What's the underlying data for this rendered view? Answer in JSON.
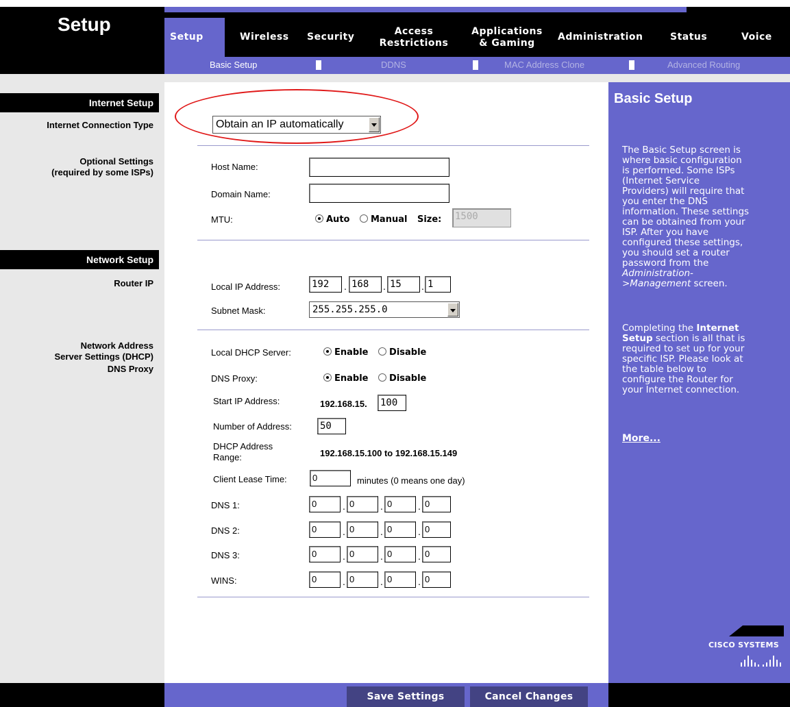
{
  "header": {
    "section_title": "Setup",
    "tabs": [
      {
        "label": "Setup"
      },
      {
        "label": "Wireless"
      },
      {
        "label": "Security"
      },
      {
        "label": "Access Restrictions",
        "line1": "Access",
        "line2": "Restrictions"
      },
      {
        "label": "Applications & Gaming",
        "line1": "Applications",
        "line2": "& Gaming"
      },
      {
        "label": "Administration"
      },
      {
        "label": "Status"
      },
      {
        "label": "Voice"
      }
    ],
    "subtabs": [
      {
        "label": "Basic Setup"
      },
      {
        "label": "DDNS"
      },
      {
        "label": "MAC Address Clone"
      },
      {
        "label": "Advanced Routing"
      }
    ]
  },
  "left": {
    "internet_setup": "Internet Setup",
    "internet_connection_type": "Internet Connection Type",
    "optional_settings_1": "Optional Settings",
    "optional_settings_2": "(required by some ISPs)",
    "network_setup": "Network Setup",
    "router_ip": "Router IP",
    "nas_1": "Network Address",
    "nas_2": "Server Settings (DHCP)",
    "dns_proxy": "DNS Proxy"
  },
  "form": {
    "connection_type": "Obtain an IP automatically",
    "host_name_label": "Host Name:",
    "host_name_value": "",
    "domain_name_label": "Domain Name:",
    "domain_name_value": "",
    "mtu_label": "MTU:",
    "mtu_auto": "Auto",
    "mtu_manual": "Manual",
    "mtu_size_label": "Size:",
    "mtu_size": "1500",
    "local_ip_label": "Local IP Address:",
    "local_ip": [
      "192",
      "168",
      "15",
      "1"
    ],
    "subnet_label": "Subnet Mask:",
    "subnet_value": "255.255.255.0",
    "dhcp_label": "Local DHCP Server:",
    "enable": "Enable",
    "disable": "Disable",
    "dns_proxy_label": "DNS Proxy:",
    "start_ip_label": "Start IP Address:",
    "start_ip_prefix": "192.168.15.",
    "start_ip_value": "100",
    "num_addr_label": "Number of Address:",
    "num_addr_value": "50",
    "range_label_1": "DHCP Address",
    "range_label_2": "Range:",
    "range_value": "192.168.15.100 to 192.168.15.149",
    "lease_label": "Client Lease Time:",
    "lease_value": "0",
    "lease_hint": "minutes (0 means one day)",
    "dns1_label": "DNS 1:",
    "dns2_label": "DNS 2:",
    "dns3_label": "DNS 3:",
    "wins_label": "WINS:",
    "dns1": [
      "0",
      "0",
      "0",
      "0"
    ],
    "dns2": [
      "0",
      "0",
      "0",
      "0"
    ],
    "dns3": [
      "0",
      "0",
      "0",
      "0"
    ],
    "wins": [
      "0",
      "0",
      "0",
      "0"
    ]
  },
  "help": {
    "title": "Basic Setup",
    "p1_lines": [
      "The Basic Setup screen is",
      "where basic configuration",
      "is performed. Some ISPs",
      "(Internet Service",
      "Providers) will require that",
      "you enter the DNS",
      "information. These settings",
      "can be obtained from your",
      "ISP. After you have",
      "configured these settings,",
      "you should set a router",
      "password from the"
    ],
    "p1_italic_1": "Administration-",
    "p1_italic_2": ">Management",
    "p1_end": " screen.",
    "p2_a": "Completing the ",
    "p2_b": "Internet",
    "p2_c": "Setup",
    "p2_d": " section is all that is",
    "p2_lines": [
      "required to set up for your",
      "specific ISP. Please look at",
      "the table below to",
      "configure the Router for",
      "your Internet connection."
    ],
    "more": "More...",
    "logo_text": "Cisco Systems"
  },
  "footer": {
    "save": "Save Settings",
    "cancel": "Cancel Changes"
  },
  "colors": {
    "accent_blue": "#6666cc",
    "button_blue": "#434383",
    "highlight_red": "#e01818"
  }
}
